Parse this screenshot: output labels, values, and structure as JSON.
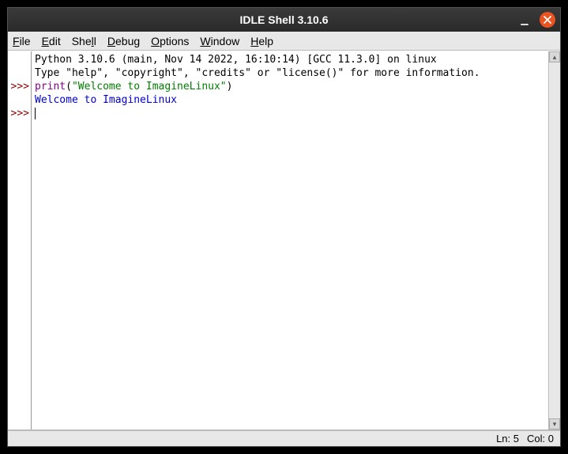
{
  "title": "IDLE Shell 3.10.6",
  "menus": {
    "file": "File",
    "edit": "Edit",
    "shell": "Shell",
    "debug": "Debug",
    "options": "Options",
    "window": "Window",
    "help": "Help"
  },
  "prompts": [
    "",
    "",
    ">>>",
    "",
    ">>>"
  ],
  "lines": {
    "banner1": "Python 3.10.6 (main, Nov 14 2022, 16:10:14) [GCC 11.3.0] on linux",
    "banner2": "Type \"help\", \"copyright\", \"credits\" or \"license()\" for more information.",
    "input_kw": "print",
    "input_paren_open": "(",
    "input_str": "\"Welcome to ImagineLinux\"",
    "input_paren_close": ")",
    "output": "Welcome to ImagineLinux"
  },
  "status": {
    "ln_label": "Ln:",
    "ln_value": "5",
    "col_label": "Col:",
    "col_value": "0"
  }
}
